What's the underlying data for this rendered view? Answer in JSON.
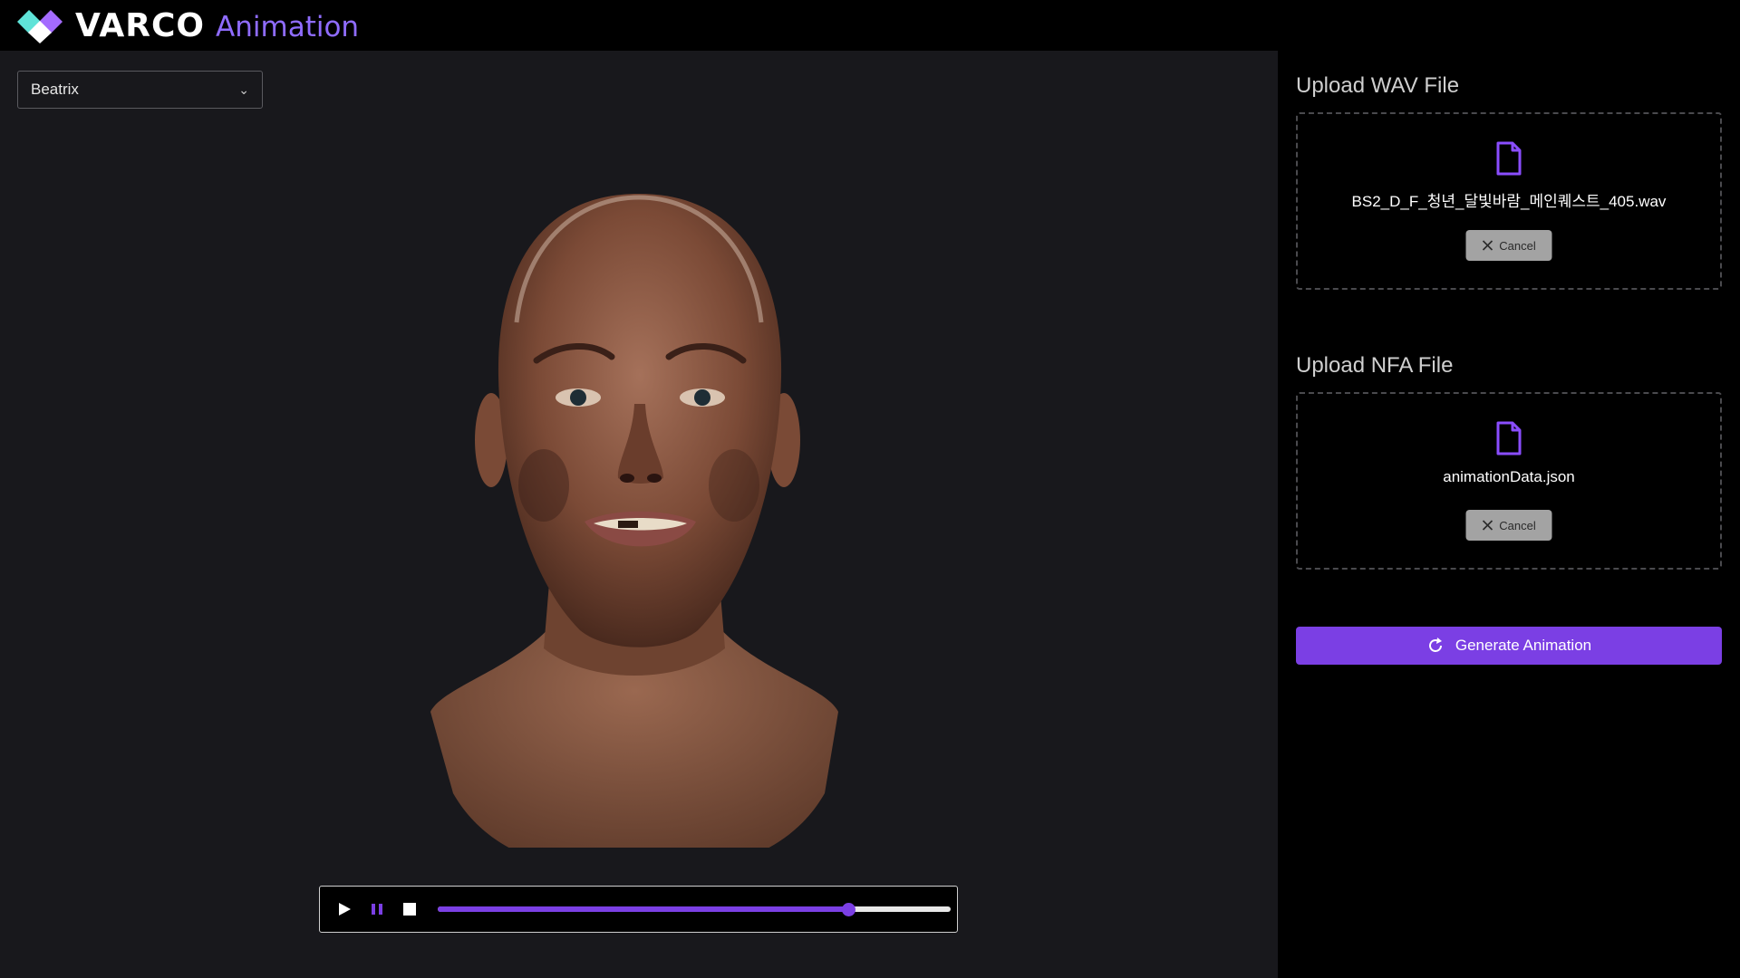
{
  "app": {
    "brand_main": "VARCO",
    "brand_sub": "Animation",
    "accent": "#7b3fe4"
  },
  "viewer": {
    "character_select": {
      "value": "Beatrix"
    },
    "player": {
      "play_icon": "play-icon",
      "pause_icon": "pause-icon",
      "stop_icon": "stop-icon",
      "progress": 0.8
    }
  },
  "panel": {
    "wav": {
      "title": "Upload WAV File",
      "file_name": "BS2_D_F_청년_달빛바람_메인퀘스트_405.wav",
      "cancel_label": "Cancel"
    },
    "nfa": {
      "title": "Upload NFA File",
      "file_name": "animationData.json",
      "cancel_label": "Cancel"
    },
    "generate_label": "Generate Animation"
  }
}
